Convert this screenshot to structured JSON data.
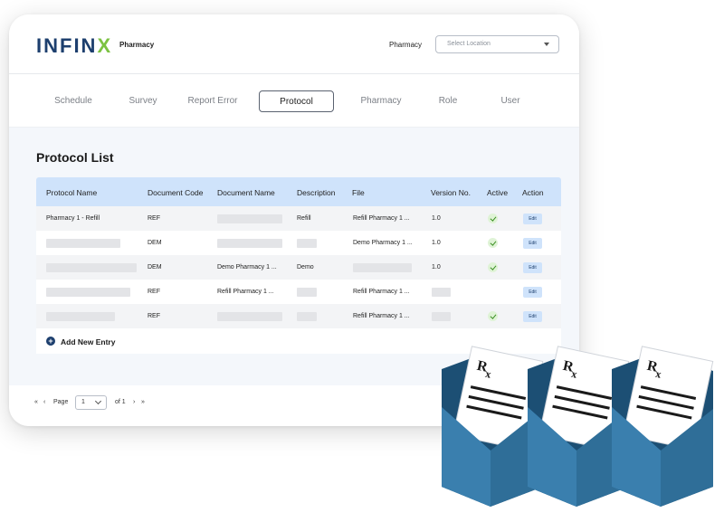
{
  "brand": {
    "logo": "INFINX",
    "app_name": "Pharmacy"
  },
  "header": {
    "location_label": "Pharmacy",
    "location_placeholder": "Select Location"
  },
  "tabs": [
    {
      "label": "Schedule"
    },
    {
      "label": "Survey"
    },
    {
      "label": "Report Error"
    },
    {
      "label": "Protocol",
      "active": true
    },
    {
      "label": "Pharmacy"
    },
    {
      "label": "Role"
    },
    {
      "label": "User"
    }
  ],
  "main": {
    "title": "Protocol List",
    "columns": [
      "Protocol Name",
      "Document Code",
      "Document Name",
      "Description",
      "File",
      "Version No.",
      "Active",
      "Action"
    ],
    "rows": [
      {
        "protocol_name": "Pharmacy 1 - Refill",
        "document_code": "REF",
        "document_name": "",
        "description": "Refill",
        "file": "Refill Pharmacy 1 ...",
        "version": "1.0",
        "active": true,
        "action": "Edit"
      },
      {
        "protocol_name": "",
        "document_code": "DEM",
        "document_name": "",
        "description": "",
        "file": "Demo Pharmacy 1 ...",
        "version": "1.0",
        "active": true,
        "action": "Edit"
      },
      {
        "protocol_name": "",
        "document_code": "DEM",
        "document_name": "Demo Pharmacy 1 ...",
        "description": "Demo",
        "file": "",
        "version": "1.0",
        "active": true,
        "action": "Edit"
      },
      {
        "protocol_name": "",
        "document_code": "REF",
        "document_name": "Refill Pharmacy 1 ...",
        "description": "",
        "file": "Refill Pharmacy 1 ...",
        "version": "",
        "active": false,
        "action": "Edit"
      },
      {
        "protocol_name": "",
        "document_code": "REF",
        "document_name": "",
        "description": "",
        "file": "Refill Pharmacy 1 ...",
        "version": "",
        "active": true,
        "action": "Edit"
      }
    ],
    "add_entry_label": "Add New Entry"
  },
  "pager": {
    "first": "«",
    "prev": "‹",
    "page_label": "Page",
    "current_page": "1",
    "of_label": "of 1",
    "next": "›",
    "last": "»"
  },
  "illustration": {
    "symbol": "Rx",
    "envelope_color": "#2f6e98",
    "envelope_dark": "#1c4f74"
  }
}
